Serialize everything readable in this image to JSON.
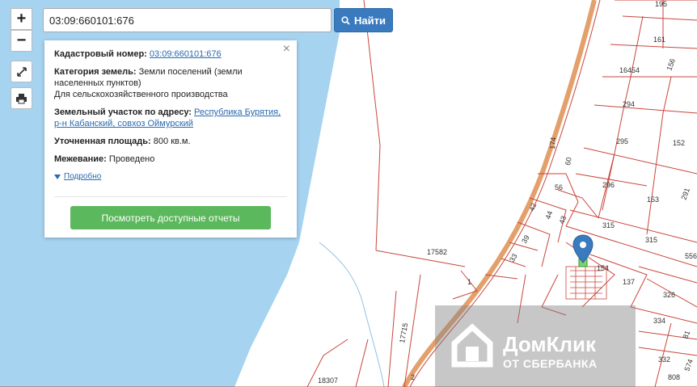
{
  "search": {
    "value": "03:09:660101:676",
    "button_label": "Найти"
  },
  "zoom": {
    "in_label": "+",
    "out_label": "−"
  },
  "tools": [
    "fullscreen-icon",
    "print-icon"
  ],
  "info": {
    "cadastral_label": "Кадастровый номер:",
    "cadastral_value": "03:09:660101:676",
    "category_label": "Категория земель:",
    "category_value": "Земли поселений (земли населенных пунктов)",
    "category_sub": "Для сельскохозяйственного производства",
    "address_label": "Земельный участок по адресу:",
    "address_value": "Республика Бурятия, р-н Кабанский, совхоз Оймурский",
    "area_label": "Уточненная площадь:",
    "area_value": "800 кв.м.",
    "survey_label": "Межевание:",
    "survey_value": "Проведено",
    "details_link": "Подробно",
    "reports_button": "Посмотреть доступные отчеты",
    "close": "×"
  },
  "map_labels": {
    "p195": "195",
    "p161": "161",
    "p16454": "16454",
    "p156": "156",
    "p294": "294",
    "p295": "295",
    "p152": "152",
    "p296": "296",
    "p153": "153",
    "p291": "291",
    "p315a": "315",
    "p315b": "315",
    "p556": "556",
    "p17582": "17582",
    "p174": "174",
    "p60": "60",
    "p56": "56",
    "p42": "42",
    "p44": "44",
    "p43": "43",
    "p39": "39",
    "p33": "33",
    "p1": "1",
    "p154": "154",
    "p137": "137",
    "p326": "326",
    "p334": "334",
    "p81": "81",
    "p17715": "17715",
    "p332": "332",
    "p808": "808",
    "p18307": "18307",
    "p574": "574",
    "p2": "2"
  },
  "watermark": {
    "brand": "ДомКлик",
    "sub": "ОТ СБЕРБАНКА"
  },
  "colors": {
    "water": "#a6d3f0",
    "road": "#e3a06b",
    "parcel_line": "#c9463c",
    "button_blue": "#3a7bbf",
    "button_green": "#5cb85c"
  }
}
